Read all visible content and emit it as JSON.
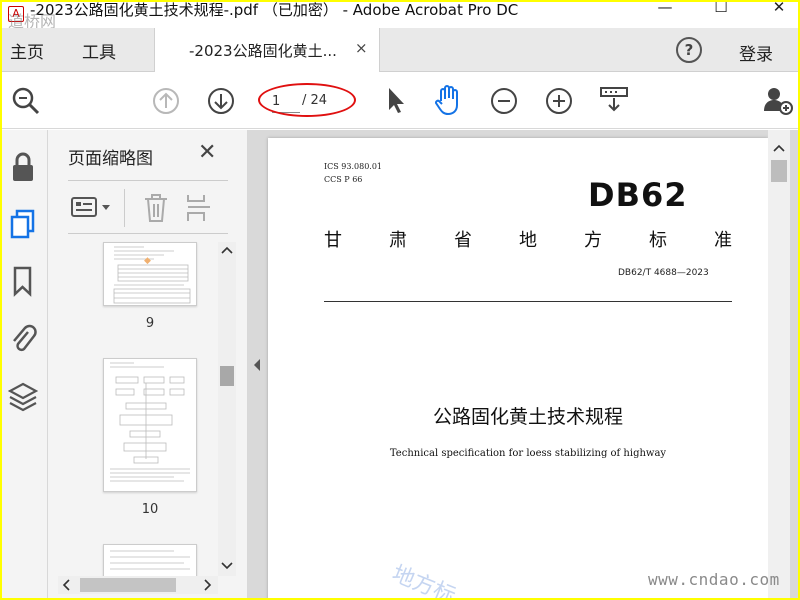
{
  "window": {
    "title": "-2023公路固化黄土技术规程-.pdf （已加密） - Adobe Acrobat Pro DC",
    "minimize": "—",
    "maximize": "☐",
    "close": "✕",
    "watermark_tl": "道桥网"
  },
  "tabs": {
    "home": "主页",
    "tools": "工具",
    "document": "-2023公路固化黄土...",
    "close": "×",
    "help": "?",
    "login": "登录"
  },
  "toolbar": {
    "current_page": "1",
    "total_pages": "/ 24"
  },
  "panel": {
    "title": "页面缩略图",
    "close": "✕",
    "thumbnails": [
      {
        "label": "9"
      },
      {
        "label": "10"
      }
    ]
  },
  "document": {
    "ics": "ICS  93.080.01",
    "ccs": "CCS  P  66",
    "logo": "DB62",
    "org_chars": [
      "甘",
      "肃",
      "省",
      "地",
      "方",
      "标",
      "准"
    ],
    "std_number": "DB62/T  4688—2023",
    "title_cn": "公路固化黄土技术规程",
    "title_en": "Technical specification for loess stabilizing of highway"
  },
  "watermarks": {
    "diagonal": "地方标",
    "site": "www.cndao.com"
  },
  "colors": {
    "frame": "#ffff00",
    "highlight_oval": "#e01010",
    "hand_tool": "#1473e6",
    "pdf_icon": "#cc0000"
  }
}
